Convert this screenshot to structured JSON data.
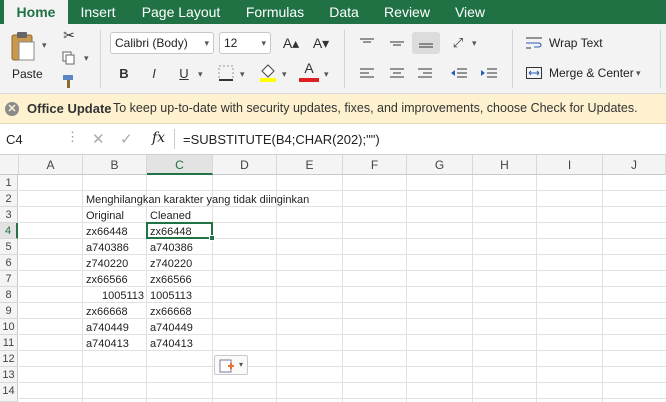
{
  "ribbon_tabs": [
    "Home",
    "Insert",
    "Page Layout",
    "Formulas",
    "Data",
    "Review",
    "View"
  ],
  "clipboard": {
    "paste_label": "Paste"
  },
  "font": {
    "family": "Calibri (Body)",
    "size": "12",
    "grow": "A▴",
    "shrink": "A▾"
  },
  "format_buttons": {
    "bold": "B",
    "italic": "I",
    "underline": "U",
    "font_color_letter": "A"
  },
  "alignment": {
    "wrap_text": "Wrap Text",
    "merge_center": "Merge & Center"
  },
  "update_bar": {
    "title": "Office Update",
    "message": "To keep up-to-date with security updates, fixes, and improvements, choose Check for Updates."
  },
  "formula_bar": {
    "name_box": "C4",
    "fx": "fx",
    "formula": "=SUBSTITUTE(B4;CHAR(202);\"\")"
  },
  "columns": [
    "A",
    "B",
    "C",
    "D",
    "E",
    "F",
    "G",
    "H",
    "I",
    "J"
  ],
  "rows": [
    "1",
    "2",
    "3",
    "4",
    "5",
    "6",
    "7",
    "8",
    "9",
    "10",
    "11",
    "12",
    "13",
    "14"
  ],
  "sheet": {
    "heading": "Menghilangkan karakter yang tidak diinginkan",
    "col_b_header": "Original",
    "col_c_header": "Cleaned",
    "original": [
      "zx66448",
      "a740386",
      "z740220",
      "zx66566",
      "1005113",
      "zx66668",
      "a740449",
      "a740413"
    ],
    "cleaned": [
      "zx66448",
      "a740386",
      "z740220",
      "zx66566",
      "1005113",
      "zx66668",
      "a740449",
      "a740413"
    ]
  },
  "colors": {
    "excel_green": "#207245",
    "font_color_bar": "#e02020",
    "fill_color_bar": "#ffff00",
    "selection": "#217346"
  },
  "icons": [
    "paste-icon",
    "cut-icon",
    "copy-icon",
    "format-painter-icon",
    "borders-icon",
    "fill-color-icon",
    "align-top-icon",
    "align-middle-icon",
    "align-bottom-icon",
    "orientation-icon",
    "align-left-icon",
    "align-center-icon",
    "align-right-icon",
    "decrease-indent-icon",
    "increase-indent-icon",
    "wrap-text-icon",
    "merge-center-icon",
    "close-icon",
    "cancel-icon",
    "enter-icon",
    "paste-options-icon"
  ]
}
